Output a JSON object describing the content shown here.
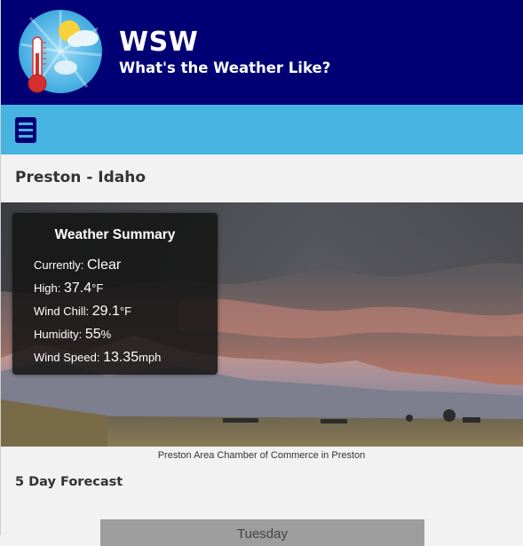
{
  "header": {
    "title": "WSW",
    "tagline": "What's the Weather Like?",
    "logo_icon": "thermometer-sun-cloud-icon"
  },
  "nav": {
    "menu_icon": "hamburger-menu-icon"
  },
  "location": {
    "heading": "Preston - Idaho"
  },
  "summary": {
    "title": "Weather Summary",
    "currently_label": "Currently:",
    "currently_value": "Clear",
    "high_label": "High:",
    "high_value": "37.4",
    "high_unit": "°F",
    "windchill_label": "Wind Chill:",
    "windchill_value": "29.1",
    "windchill_unit": "°F",
    "humidity_label": "Humidity:",
    "humidity_value": "55",
    "humidity_unit": "%",
    "windspeed_label": "Wind Speed:",
    "windspeed_value": "13.35",
    "windspeed_unit": "mph"
  },
  "hero": {
    "caption": "Preston Area Chamber of Commerce in Preston"
  },
  "forecast": {
    "title": "5 Day Forecast",
    "days": [
      "Tuesday"
    ]
  },
  "colors": {
    "header_bg": "#000074",
    "nav_bg": "#46b3e1",
    "page_bg": "#f2f2f2"
  }
}
